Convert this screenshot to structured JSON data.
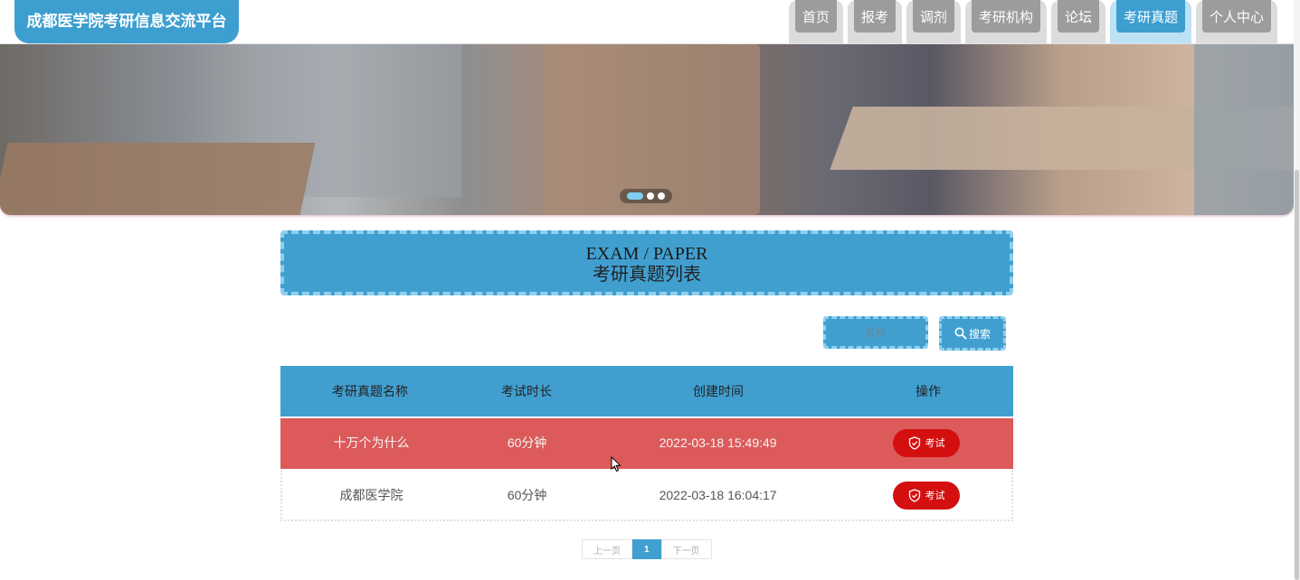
{
  "header": {
    "site_title": "成都医学院考研信息交流平台",
    "nav": [
      {
        "label": "首页",
        "active": false
      },
      {
        "label": "报考",
        "active": false
      },
      {
        "label": "调剂",
        "active": false
      },
      {
        "label": "考研机构",
        "active": false
      },
      {
        "label": "论坛",
        "active": false
      },
      {
        "label": "考研真题",
        "active": true
      },
      {
        "label": "个人中心",
        "active": false
      }
    ]
  },
  "banner": {
    "slides": 3,
    "active_slide": 1
  },
  "section": {
    "title_en": "EXAM / PAPER",
    "title_cn": "考研真题列表"
  },
  "search": {
    "placeholder": "名称",
    "value": "",
    "button_label": "搜索",
    "icon": "search-icon"
  },
  "table": {
    "headers": [
      "考研真题名称",
      "考试时长",
      "创建时间",
      "操作"
    ],
    "rows": [
      {
        "name": "十万个为什么",
        "duration": "60分钟",
        "created": "2022-03-18 15:49:49",
        "action": "考试",
        "highlighted": true
      },
      {
        "name": "成都医学院",
        "duration": "60分钟",
        "created": "2022-03-18 16:04:17",
        "action": "考试",
        "highlighted": false
      }
    ]
  },
  "pagination": {
    "prev": "上一页",
    "current": "1",
    "next": "下一页"
  },
  "colors": {
    "primary": "#419fd0",
    "highlight_row": "#dc5a5a",
    "action_button": "#d40f0f",
    "nav_inactive": "#9c9c9c"
  }
}
